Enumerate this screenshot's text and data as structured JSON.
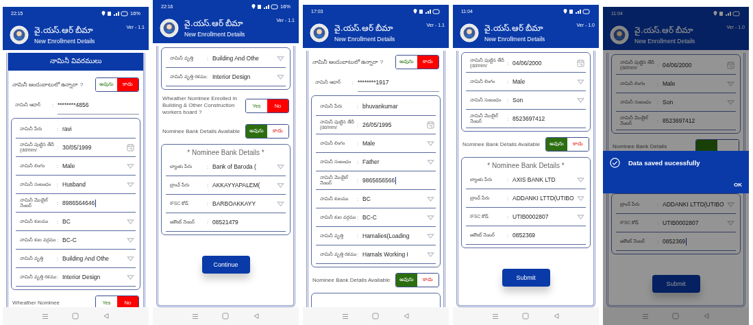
{
  "separator": ":",
  "screens": [
    {
      "status": {
        "time": "22:15",
        "battery": "16%"
      },
      "header": {
        "title": "వై.యస్.ఆర్ బీమా",
        "subtitle": "New Enrollment Details",
        "version": "Ver - 1.1"
      },
      "blocks": [
        {
          "kind": "section_title",
          "text": "నామినీ వివరములు"
        },
        {
          "kind": "toggle",
          "label": "నామినీ అందుబాటులో ఉన్నారా ?",
          "options": [
            {
              "label": "అవును",
              "selected": false
            },
            {
              "label": "కాదు",
              "selected": true
            }
          ]
        },
        {
          "kind": "text",
          "label": "నామినీ ఆధార్",
          "value": "********4856"
        },
        {
          "kind": "group",
          "children": [
            {
              "kind": "text",
              "label": "నామినీ పేరు",
              "value": "ravi"
            },
            {
              "kind": "date",
              "label": "నామినీ పుట్టిన తేదీ (dd/mm/",
              "value": "30/05/1999"
            },
            {
              "kind": "dropdown",
              "label": "నామినీ లింగం",
              "value": "Male"
            },
            {
              "kind": "dropdown",
              "label": "నామినీ సంబంధం",
              "value": "Husband"
            },
            {
              "kind": "text",
              "label": "నామినీ మొబైల్ నెంబర్",
              "value": "8986564646",
              "cursor": true
            },
            {
              "kind": "dropdown",
              "label": "నామినీ కులము",
              "value": "BC"
            },
            {
              "kind": "dropdown",
              "label": "నామినీ కుల వర్గము",
              "value": "BC-C"
            },
            {
              "kind": "dropdown",
              "label": "నామినీ వృత్తి",
              "value": "Building And Othe"
            },
            {
              "kind": "dropdown",
              "label": "నామినీ వృత్తి రకము",
              "value": "Interior Design"
            }
          ]
        },
        {
          "kind": "toggle",
          "label": "Wheather Nominee",
          "options": [
            {
              "label": "Yes",
              "selected": false
            },
            {
              "label": "No",
              "selected": true
            }
          ]
        }
      ]
    },
    {
      "status": {
        "time": "22:16",
        "battery": "16%"
      },
      "header": {
        "title": "వై.యస్.ఆర్ బీమా",
        "subtitle": "New Enrollment Details",
        "version": "Ver - 1.1"
      },
      "blocks": [
        {
          "kind": "group",
          "children": [
            {
              "kind": "dropdown",
              "label": "నామినీ వృత్తి",
              "value": "Building And Othe"
            },
            {
              "kind": "dropdown",
              "label": "నామినీ వృత్తి రకము",
              "value": "Interior Design"
            }
          ]
        },
        {
          "kind": "toggle",
          "label": "Wheather Nominee Enrolled in Building & Other Construction workers board ?",
          "options": [
            {
              "label": "Yes",
              "selected": false
            },
            {
              "label": "No",
              "selected": true
            }
          ]
        },
        {
          "kind": "toggle",
          "label": "Nominee Bank Details Available",
          "options": [
            {
              "label": "అవును",
              "selected": true
            },
            {
              "label": "కాదు",
              "selected": false
            }
          ]
        },
        {
          "kind": "group",
          "title": "* Nominee Bank Details *",
          "children": [
            {
              "kind": "dropdown",
              "label": "బ్యాంకు పేరు",
              "value": "Bank of Baroda ("
            },
            {
              "kind": "dropdown",
              "label": "బ్రాంచ్ పేరు",
              "value": "AKKAYYAPALEM("
            },
            {
              "kind": "dropdown",
              "label": "IFSC కోడ్",
              "value": "BARBOAKKAYY"
            },
            {
              "kind": "text",
              "label": "అకౌంట్ నెంబర్",
              "value": "08521479"
            }
          ]
        },
        {
          "kind": "button",
          "label": "Continue"
        }
      ]
    },
    {
      "status": {
        "time": "17:03"
      },
      "header": {
        "title": "వై.యస్.ఆర్ బీమా",
        "subtitle": "New Enrollment Details",
        "version": "Ver - 1.1"
      },
      "blocks": [
        {
          "kind": "toggle",
          "label": "నామినీ అందుబాటులో ఉన్నారా ?",
          "options": [
            {
              "label": "అవును",
              "selected": false
            },
            {
              "label": "కాదు",
              "selected": true
            }
          ]
        },
        {
          "kind": "text",
          "label": "నామినీ ఆధార్",
          "value": "********1917"
        },
        {
          "kind": "group",
          "children": [
            {
              "kind": "text",
              "label": "నామినీ పేరు",
              "value": "bhuvankumar"
            },
            {
              "kind": "date",
              "label": "నామినీ పుట్టిన తేదీ (dd/mm/",
              "value": "26/05/1995"
            },
            {
              "kind": "dropdown",
              "label": "నామినీ లింగం",
              "value": "Male"
            },
            {
              "kind": "dropdown",
              "label": "నామినీ సంబంధం",
              "value": "Father"
            },
            {
              "kind": "text",
              "label": "నామినీ మొబైల్ నెంబర్",
              "value": "9865656566",
              "cursor": true
            },
            {
              "kind": "dropdown",
              "label": "నామినీ కులము",
              "value": "BC"
            },
            {
              "kind": "dropdown",
              "label": "నామినీ కుల వర్గము",
              "value": "BC-C"
            },
            {
              "kind": "dropdown",
              "label": "నామినీ వృత్తి",
              "value": "Hamalies(Loading"
            },
            {
              "kind": "dropdown",
              "label": "నామినీ వృత్తి రకము",
              "value": "Hamals Working I"
            }
          ]
        },
        {
          "kind": "toggle",
          "label": "Nominee Bank Details Available",
          "options": [
            {
              "label": "అవును",
              "selected": true
            },
            {
              "label": "కాదు",
              "selected": false
            }
          ]
        },
        {
          "kind": "group"
        }
      ]
    },
    {
      "status": {
        "time": "11:04"
      },
      "header": {
        "title": "వై.యస్.ఆర్ బీమా",
        "subtitle": "New Enrollment Details",
        "version": "Ver - 1.0"
      },
      "blocks": [
        {
          "kind": "group",
          "children": [
            {
              "kind": "date",
              "label": "నామినీ పుట్టిన తేదీ (dd/mm/",
              "value": "04/06/2000"
            },
            {
              "kind": "dropdown",
              "label": "నామినీ లింగం",
              "value": "Male"
            },
            {
              "kind": "dropdown",
              "label": "నామినీ సంబంధం",
              "value": "Son"
            },
            {
              "kind": "text",
              "label": "నామినీ మొబైల్ నెంబర్",
              "value": "8523697412"
            }
          ]
        },
        {
          "kind": "toggle",
          "label": "Nominee Bank Details Available",
          "options": [
            {
              "label": "అవును",
              "selected": true
            },
            {
              "label": "కాదు",
              "selected": false
            }
          ]
        },
        {
          "kind": "group",
          "title": "* Nominee Bank Details *",
          "children": [
            {
              "kind": "dropdown",
              "label": "బ్యాంకు పేరు",
              "value": "AXIS BANK LTD"
            },
            {
              "kind": "dropdown",
              "label": "బ్రాంచ్ పేరు",
              "value": "ADDANKI LTTD(UTIBO"
            },
            {
              "kind": "dropdown",
              "label": "IFSC కోడ్",
              "value": "UTIB0002807"
            },
            {
              "kind": "text",
              "label": "అకౌంట్ నెంబర్",
              "value": "0852369"
            }
          ]
        },
        {
          "kind": "button",
          "label": "Submit"
        }
      ]
    },
    {
      "status": {
        "time": "11:04"
      },
      "header": {
        "title": "వై.యస్.ఆర్ బీమా",
        "subtitle": "New Enrollment Details",
        "version": "Ver - 1.0"
      },
      "blocks": [
        {
          "kind": "group",
          "children": [
            {
              "kind": "date",
              "label": "నామినీ పుట్టిన తేదీ (dd/mm/",
              "value": "04/06/2000"
            },
            {
              "kind": "dropdown",
              "label": "నామినీ లింగం",
              "value": "Male"
            },
            {
              "kind": "dropdown",
              "label": "నామినీ సంబంధం",
              "value": "Son"
            },
            {
              "kind": "text",
              "label": "నామినీ మొబైల్ నెంబర్",
              "value": "8523697412"
            }
          ]
        },
        {
          "kind": "toggle",
          "label": "Nominee Bank Details",
          "options": [
            {
              "selected": true
            },
            {
              "selected": false
            }
          ]
        },
        {
          "kind": "dialog",
          "message": "Data saved sucessfully",
          "button": "OK"
        },
        {
          "kind": "group",
          "children": [
            {
              "kind": "dropdown",
              "label": "బ్రాంచ్ పేరు",
              "value": "ADDANKI LTTD(UTIBO"
            },
            {
              "kind": "dropdown",
              "label": "IFSC కోడ్",
              "value": "UTIB0002807"
            },
            {
              "kind": "text",
              "label": "అకౌంట్ నెంబర్",
              "value": "0852369",
              "cursor": true
            }
          ]
        },
        {
          "kind": "button",
          "label": "Submit"
        }
      ]
    }
  ]
}
